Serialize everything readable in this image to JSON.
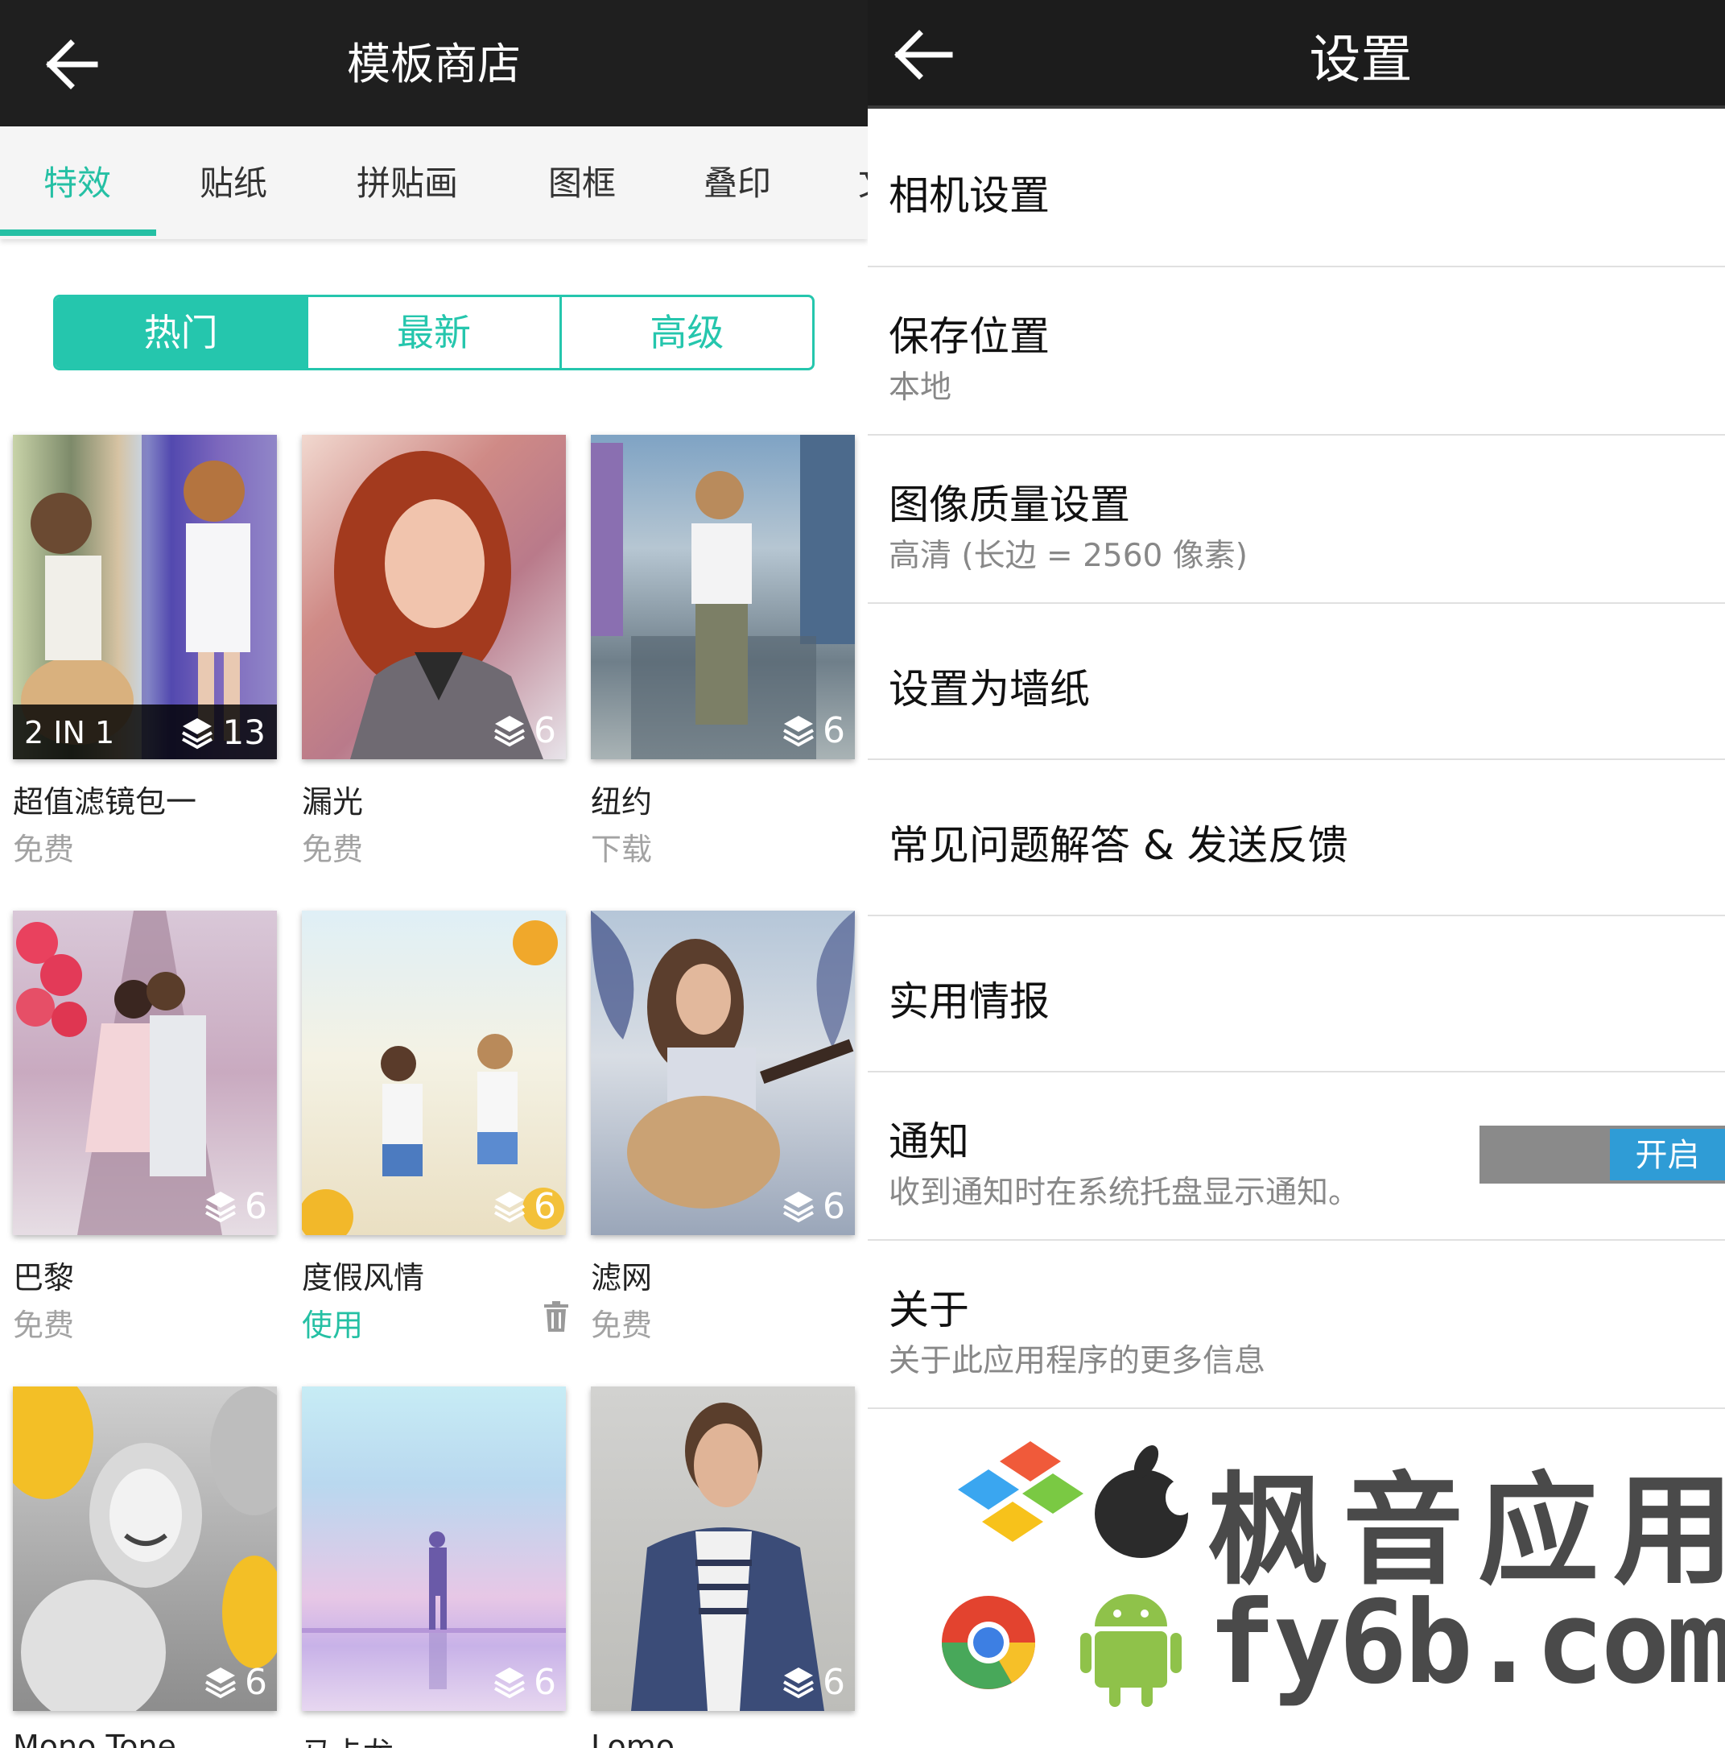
{
  "store": {
    "title": "模板商店",
    "tabs": [
      "特效",
      "贴纸",
      "拼贴画",
      "图框",
      "叠印",
      "文"
    ],
    "active_tab": 0,
    "segments": [
      "热门",
      "最新",
      "高级"
    ],
    "active_segment": 0,
    "accent_color": "#25c0a4",
    "cards": [
      {
        "name": "超值滤镜包一",
        "status": "免费",
        "badge_label": "2 IN 1",
        "layers": "13"
      },
      {
        "name": "漏光",
        "status": "免费",
        "layers": "6"
      },
      {
        "name": "纽约",
        "status": "下载",
        "layers": "6"
      },
      {
        "name": "巴黎",
        "status": "免费",
        "layers": "6"
      },
      {
        "name": "度假风情",
        "status": "使用",
        "layers": "6"
      },
      {
        "name": "滤网",
        "status": "免费",
        "layers": "6"
      },
      {
        "name": "Mono Tone",
        "status": "",
        "layers": "6"
      },
      {
        "name": "马卡龙",
        "status": "",
        "layers": "6"
      },
      {
        "name": "Lomo",
        "status": "",
        "layers": "6"
      }
    ]
  },
  "settings": {
    "title": "设置",
    "items": [
      {
        "title": "相机设置"
      },
      {
        "title": "保存位置",
        "subtitle": "本地"
      },
      {
        "title": "图像质量设置",
        "subtitle": "高清 (长边 = 2560 像素)"
      },
      {
        "title": "设置为墙纸"
      },
      {
        "title": "常见问题解答 & 发送反馈"
      },
      {
        "title": "实用情报"
      },
      {
        "title": "通知",
        "subtitle": "收到通知时在系统托盘显示通知。"
      },
      {
        "title": "关于",
        "subtitle": "关于此应用程序的更多信息"
      }
    ],
    "toggle_label": "开启",
    "toggle_color": "#2f9cd6"
  },
  "watermark": {
    "line1": "枫音应用",
    "line2": "fy6b.com"
  }
}
